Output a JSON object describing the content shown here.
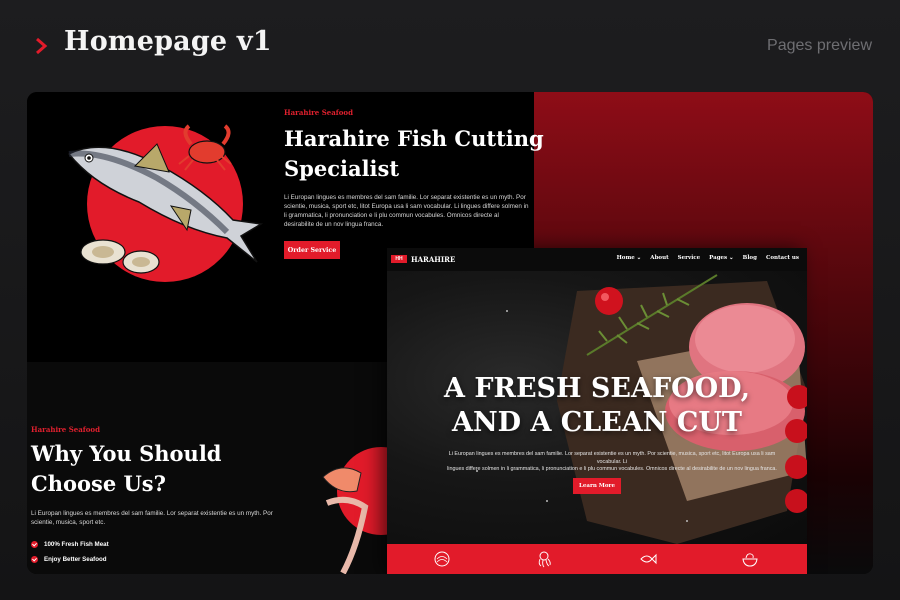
{
  "header": {
    "title": "Homepage v1",
    "preview_label": "Pages preview",
    "accent": "#e21b2a"
  },
  "hero_section": {
    "eyebrow": "Harahire Seafood",
    "title_line1": "Harahire Fish Cutting",
    "title_line2": "Specialist",
    "body_line1": "Li Europan lingues es membres del sam familie. Lor separat existentie es un myth. Por",
    "body_line2": "scientie, musica, sport etc, litot Europa usa li sam vocabular. Li lingues differe solmen in",
    "body_line3": "li grammatica, li pronunciation e li plu commun vocabules. Omnicos directe al",
    "body_line4": "desirabilite de un nov lingua franca.",
    "button_label": "Order Service"
  },
  "why_section": {
    "eyebrow": "Harahire Seafood",
    "title_line1": "Why You Should",
    "title_line2": "Choose Us?",
    "body_line1": "Li Europan lingues es membres del sam familie. Lor separat existentie es un myth. Por",
    "body_line2": "scientie, musica, sport etc.",
    "checklist": [
      "100% Fresh Fish Meat",
      "Enjoy Better Seafood"
    ]
  },
  "site_preview": {
    "logo_text": "HH",
    "brand": "HARAHIRE",
    "menu": [
      "Home ⌄",
      "About",
      "Service",
      "Pages ⌄",
      "Blog",
      "Contact us"
    ],
    "hero_line1": "A FRESH SEAFOOD,",
    "hero_line2": "AND A CLEAN CUT",
    "hero_desc_line1": "Li Europan lingues es membres del sam familie. Lor separat existentie es un myth. Por scientie, musica, sport etc, litot Europa usa li sam vocabular. Li",
    "hero_desc_line2": "lingues differe solmen in li grammatica, li pronunciation e li plu commun vocabules. Omnicos directe al desirabilite de un nov lingua franca.",
    "button_label": "Learn More",
    "strip_icons": [
      "fish-scale-icon",
      "octopus-icon",
      "fish-icon",
      "shrimp-bowl-icon"
    ]
  }
}
